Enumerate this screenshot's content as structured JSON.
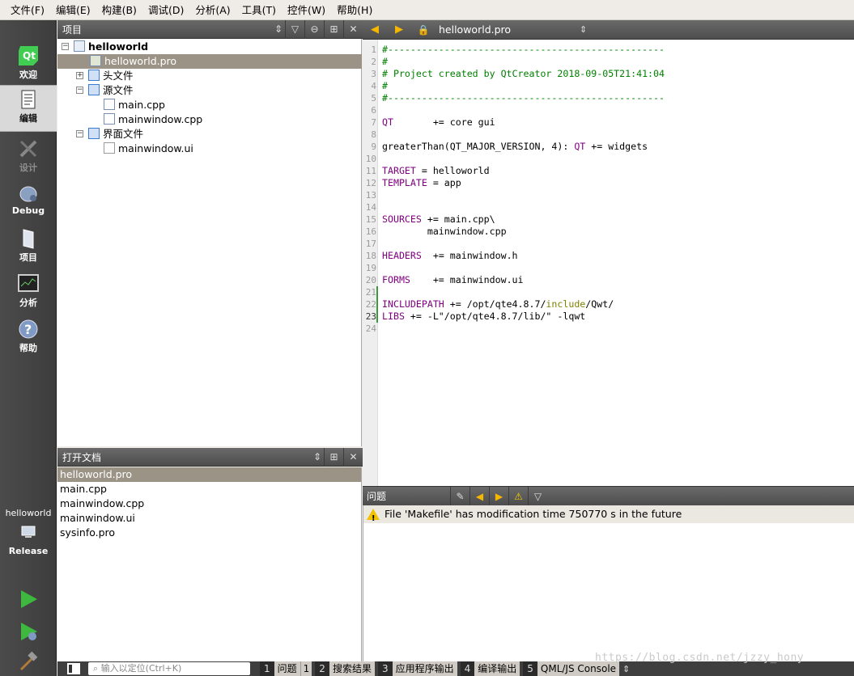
{
  "menu": [
    "文件(F)",
    "编辑(E)",
    "构建(B)",
    "调试(D)",
    "分析(A)",
    "工具(T)",
    "控件(W)",
    "帮助(H)"
  ],
  "modes": [
    {
      "label": "欢迎",
      "icon": "qt-logo-icon"
    },
    {
      "label": "编辑",
      "icon": "edit-document-icon"
    },
    {
      "label": "设计",
      "icon": "design-tools-icon"
    },
    {
      "label": "Debug",
      "icon": "debug-bug-icon"
    },
    {
      "label": "项目",
      "icon": "project-folder-icon"
    },
    {
      "label": "分析",
      "icon": "analyze-monitor-icon"
    },
    {
      "label": "帮助",
      "icon": "help-question-icon"
    }
  ],
  "kit": {
    "project": "helloworld",
    "config": "Release"
  },
  "project_panel": {
    "title": "项目",
    "root": "helloworld",
    "pro_file": "helloworld.pro",
    "headers_folder": "头文件",
    "sources_folder": "源文件",
    "sources": [
      "main.cpp",
      "mainwindow.cpp"
    ],
    "forms_folder": "界面文件",
    "forms": [
      "mainwindow.ui"
    ]
  },
  "open_docs": {
    "title": "打开文档",
    "items": [
      "helloworld.pro",
      "main.cpp",
      "mainwindow.cpp",
      "mainwindow.ui",
      "sysinfo.pro"
    ]
  },
  "editor": {
    "filename": "helloworld.pro",
    "current_line": 23,
    "lines": [
      "#-------------------------------------------------",
      "#",
      "# Project created by QtCreator 2018-09-05T21:41:04",
      "#",
      "#-------------------------------------------------",
      "",
      "QT       += core gui",
      "",
      "greaterThan(QT_MAJOR_VERSION, 4): QT += widgets",
      "",
      "TARGET = helloworld",
      "TEMPLATE = app",
      "",
      "",
      "SOURCES += main.cpp\\",
      "        mainwindow.cpp",
      "",
      "HEADERS  += mainwindow.h",
      "",
      "FORMS    += mainwindow.ui",
      "",
      "INCLUDEPATH += /opt/qte4.8.7/include/Qwt/",
      "LIBS += -L\"/opt/qte4.8.7/lib/\" -lqwt",
      ""
    ]
  },
  "issues": {
    "title": "问题",
    "message": "File 'Makefile' has modification time 750770 s in the future"
  },
  "status": {
    "locator_placeholder": "输入以定位(Ctrl+K)",
    "tabs": [
      {
        "num": "1",
        "label": "问题",
        "badge": "1"
      },
      {
        "num": "2",
        "label": "搜索结果"
      },
      {
        "num": "3",
        "label": "应用程序输出"
      },
      {
        "num": "4",
        "label": "编译输出"
      },
      {
        "num": "5",
        "label": "QML/JS Console"
      }
    ]
  },
  "watermark": "https://blog.csdn.net/jzzy_hony",
  "colors": {
    "comment": "#008000",
    "keyword": "#800080",
    "include": "#808000",
    "selection": "#9b9386"
  }
}
